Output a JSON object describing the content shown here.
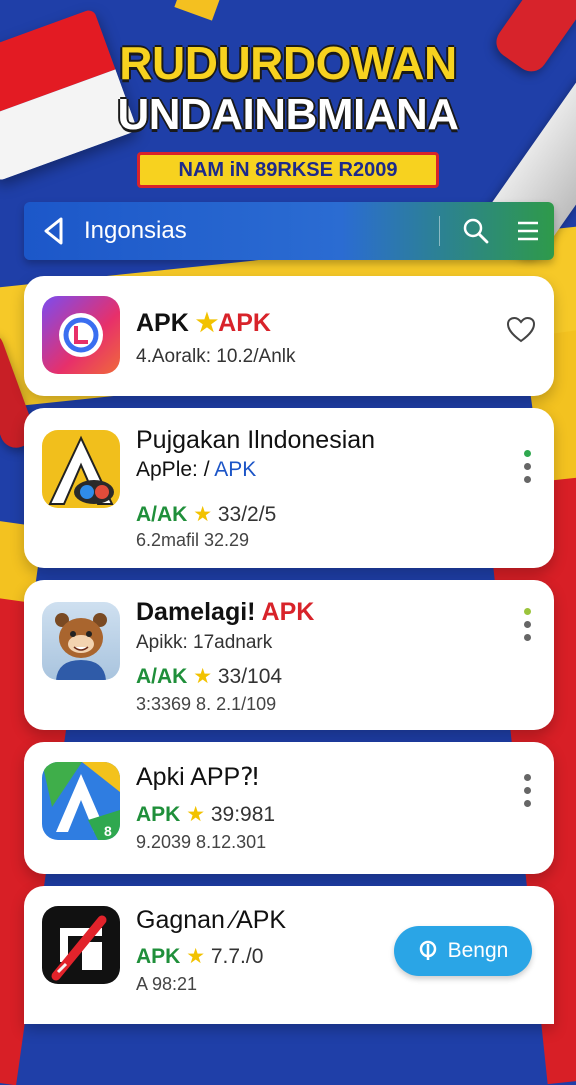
{
  "header": {
    "title_line1": "RUDURDOWAN",
    "title_line2": "UNDAINBMIANA",
    "subtitle": "NAM iN 89RKSE R2009"
  },
  "appbar": {
    "title": "Ingonsias",
    "back_icon": "back-arrow-icon",
    "search_icon": "search-icon",
    "menu_icon": "hamburger-menu-icon",
    "gradient": [
      "#1c57c9",
      "#2e9a4a"
    ]
  },
  "apps": [
    {
      "name": "APK",
      "name_suffix": "APK",
      "line1": "4.Aoralk: 10.2/Anlk",
      "action": "heart-icon"
    },
    {
      "name": "Pujgakan Ilndonesian",
      "line1_prefix": "ApPle: /",
      "line1_accent": "APK",
      "rating_label": "A/AK",
      "rating": "33/2/5",
      "stats": "6.2mafil  32.29",
      "action": "more-vert-icon"
    },
    {
      "name": "Damelagi",
      "name_accent": "APK",
      "line1": "Apikk: 17adnark",
      "rating_label": "A/AK",
      "rating": "33/104",
      "stats": "3:3369 8. 2.1/109",
      "action": "more-vert-icon"
    },
    {
      "name": "Apki APP",
      "name_suffix": "⁈",
      "rating_label": "APK",
      "rating": "39:981",
      "stats": "9.2039 8.12.301",
      "action": "more-vert-icon"
    },
    {
      "name": "Gagnan ⁄APK",
      "rating_label": "APK",
      "rating": "7.7./0",
      "stats": "A 98:21",
      "button_label": "Bengn"
    }
  ],
  "colors": {
    "accent_red": "#d8232a",
    "accent_blue": "#1c55c7",
    "rating_green": "#1f8f3a",
    "star_yellow": "#f2c200",
    "install_button": "#2aa5e6"
  }
}
